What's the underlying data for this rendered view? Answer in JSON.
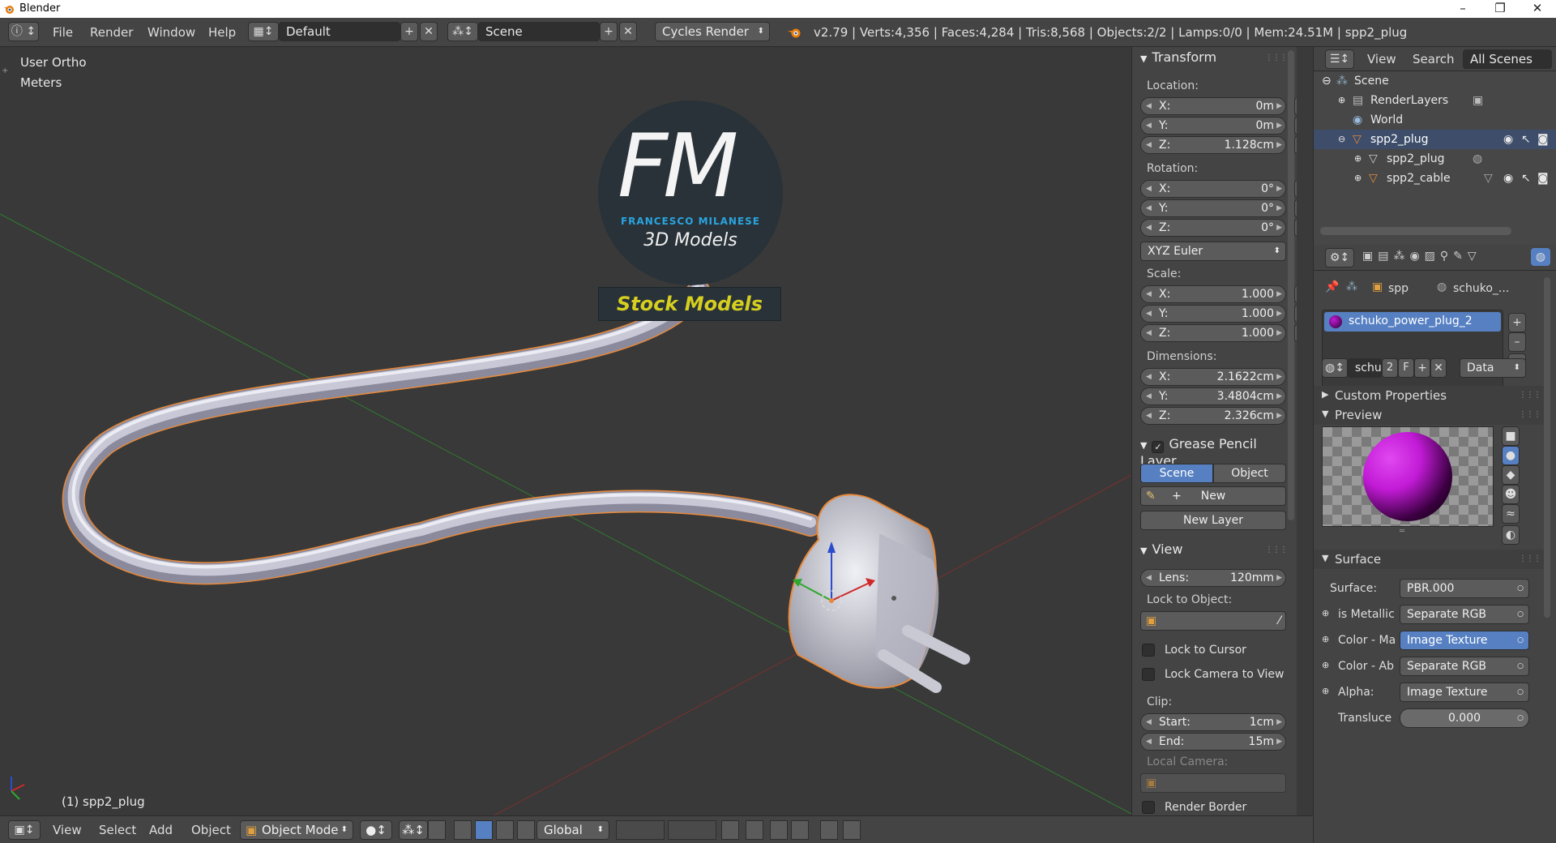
{
  "window": {
    "title": "Blender",
    "minimize": "–",
    "maximize": "❐",
    "close": "✕"
  },
  "info_header": {
    "menus": [
      "File",
      "Render",
      "Window",
      "Help"
    ],
    "screen_layout": "Default",
    "scene": "Scene",
    "render_engine": "Cycles Render",
    "stats": "v2.79 | Verts:4,356 | Faces:4,284 | Tris:8,568 | Objects:2/2 | Lamps:0/0 | Mem:24.51M | spp2_plug"
  },
  "viewport": {
    "view_name": "User Ortho",
    "units": "Meters",
    "object_label": "(1) spp2_plug",
    "watermark": {
      "logo_text": "FM",
      "author": "FRANCESCO MILANESE",
      "subtitle": "3D Models",
      "banner": "Stock Models"
    }
  },
  "npanel": {
    "transform": {
      "header": "Transform",
      "location_label": "Location:",
      "location": [
        {
          "axis": "X:",
          "value": "0m"
        },
        {
          "axis": "Y:",
          "value": "0m"
        },
        {
          "axis": "Z:",
          "value": "1.128cm"
        }
      ],
      "rotation_label": "Rotation:",
      "rotation": [
        {
          "axis": "X:",
          "value": "0°"
        },
        {
          "axis": "Y:",
          "value": "0°"
        },
        {
          "axis": "Z:",
          "value": "0°"
        }
      ],
      "rotation_mode": "XYZ Euler",
      "scale_label": "Scale:",
      "scale": [
        {
          "axis": "X:",
          "value": "1.000"
        },
        {
          "axis": "Y:",
          "value": "1.000"
        },
        {
          "axis": "Z:",
          "value": "1.000"
        }
      ],
      "dimensions_label": "Dimensions:",
      "dimensions": [
        {
          "axis": "X:",
          "value": "2.1622cm"
        },
        {
          "axis": "Y:",
          "value": "3.4804cm"
        },
        {
          "axis": "Z:",
          "value": "2.326cm"
        }
      ]
    },
    "grease_pencil": {
      "header": "Grease Pencil Layer",
      "scene_tab": "Scene",
      "object_tab": "Object",
      "new_label": "New",
      "new_layer_label": "New Layer"
    },
    "view": {
      "header": "View",
      "lens_label": "Lens:",
      "lens_value": "120mm",
      "lock_object_label": "Lock to Object:",
      "lock_cursor": "Lock to Cursor",
      "lock_camera": "Lock Camera to View",
      "clip_label": "Clip:",
      "clip_start_label": "Start:",
      "clip_start": "1cm",
      "clip_end_label": "End:",
      "clip_end": "15m",
      "local_camera_label": "Local Camera:",
      "render_border": "Render Border"
    }
  },
  "outliner": {
    "menus": [
      "View",
      "Search"
    ],
    "filter": "All Scenes",
    "items": [
      {
        "name": "Scene",
        "selected": false
      },
      {
        "name": "RenderLayers",
        "selected": false
      },
      {
        "name": "World",
        "selected": false
      },
      {
        "name": "spp2_plug",
        "selected": true
      },
      {
        "name": "spp2_plug",
        "selected": false
      },
      {
        "name": "spp2_cable",
        "selected": false
      }
    ]
  },
  "properties": {
    "breadcrumb": {
      "object": "spp",
      "material": "schuko_..."
    },
    "material_slot": "schuko_power_plug_2",
    "datablock": {
      "name": "schu",
      "users": "2",
      "fake": "F",
      "link": "Data"
    },
    "panels": {
      "custom_props": "Custom Properties",
      "preview": "Preview",
      "surface": "Surface"
    },
    "surface_rows": [
      {
        "label": "Surface:",
        "value": "PBR.000"
      },
      {
        "label": "is Metallic",
        "value": "Separate RGB"
      },
      {
        "label": "Color - Ma",
        "value": "Image Texture"
      },
      {
        "label": "Color - Ab",
        "value": "Separate RGB"
      },
      {
        "label": "Alpha:",
        "value": "Image Texture"
      }
    ],
    "translucency_label": "Transluce",
    "translucency_value": "0.000"
  },
  "bottom_bar": {
    "menus": [
      "View",
      "Select",
      "Add",
      "Object"
    ],
    "mode": "Object Mode",
    "orientation": "Global"
  },
  "colors": {
    "accent": "#5680c2",
    "selected_outline": "#e8893a",
    "material_purple": "#c21bd6",
    "logo_blue": "#2aa4e0",
    "banner_yellow": "#d6cf1f"
  }
}
